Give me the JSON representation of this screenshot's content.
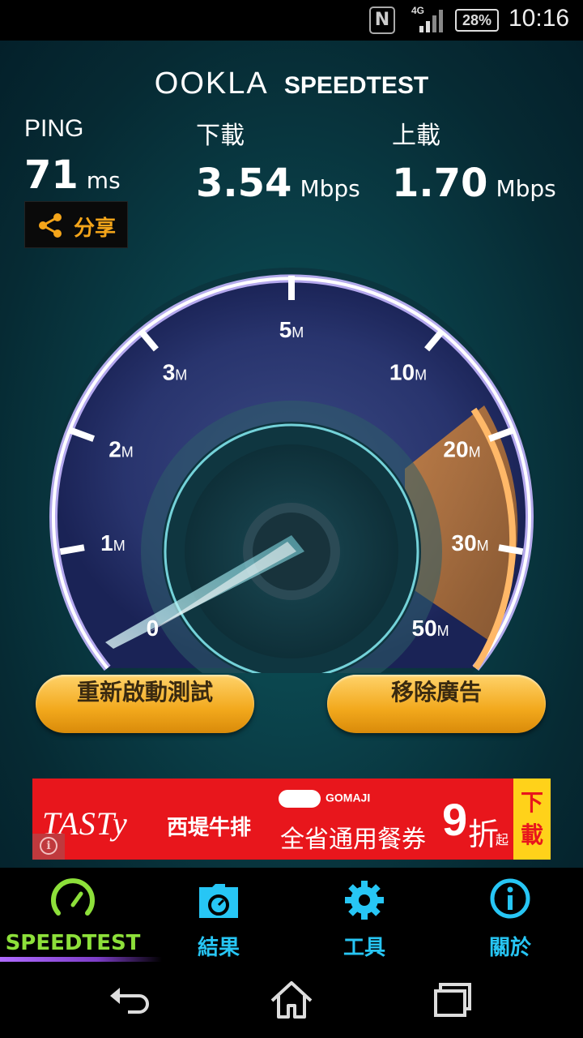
{
  "status_bar": {
    "network": "4G",
    "battery": "28%",
    "time": "10:16",
    "icons": [
      "nfc-icon",
      "signal-icon",
      "battery-icon"
    ]
  },
  "header": {
    "brand": "OOKLA",
    "product": "SPEEDTEST"
  },
  "metrics": {
    "ping": {
      "label": "PING",
      "value": "71",
      "unit": "ms"
    },
    "download": {
      "label": "下載",
      "value": "3.54",
      "unit": "Mbps"
    },
    "upload": {
      "label": "上載",
      "value": "1.70",
      "unit": "Mbps"
    }
  },
  "share": {
    "label": "分享",
    "icon": "share-icon"
  },
  "gauge": {
    "scale_labels": [
      "0",
      "1M",
      "2M",
      "3M",
      "5M",
      "10M",
      "20M",
      "30M",
      "50M"
    ],
    "needle_value_mbps": 0.2
  },
  "actions": {
    "restart": "重新啟動測試",
    "remove_ads": "移除廣告"
  },
  "ad": {
    "brand": "TASTy",
    "brand_sub": "西堤牛排",
    "partner": "GOMAJI",
    "copy": "全省通用餐券",
    "discount_num": "9",
    "discount_unit": "折",
    "discount_suffix": "起",
    "download_cta": "下載",
    "colors": {
      "bg": "#e8161c",
      "cta_bg": "#ffd21a"
    }
  },
  "tabs": [
    {
      "label": "SPEEDTEST",
      "icon": "speedometer-icon",
      "color": "#8de03a",
      "active": true
    },
    {
      "label": "結果",
      "icon": "results-folder-icon",
      "color": "#27c6f5",
      "active": false
    },
    {
      "label": "工具",
      "icon": "gear-icon",
      "color": "#27c6f5",
      "active": false
    },
    {
      "label": "關於",
      "icon": "info-icon",
      "color": "#27c6f5",
      "active": false
    }
  ],
  "navigation": {
    "back": "back-icon",
    "home": "home-icon",
    "recents": "recents-icon"
  }
}
